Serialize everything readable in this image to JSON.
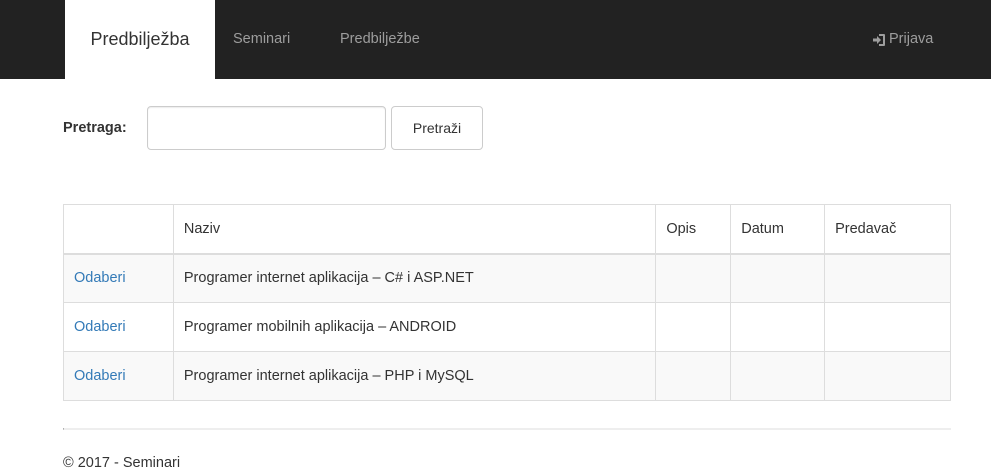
{
  "navbar": {
    "brand": "Predbilježba",
    "links": [
      {
        "label": "Seminari"
      },
      {
        "label": "Predbilježbe"
      }
    ],
    "login": {
      "label": "Prijava",
      "icon": "log-in-icon"
    },
    "background": "#222222",
    "link_color": "#9d9d9d"
  },
  "search": {
    "label": "Pretraga:",
    "value": "",
    "placeholder": "",
    "button_label": "Pretraži"
  },
  "table": {
    "headers": [
      "",
      "Naziv",
      "Opis",
      "Datum",
      "Predavač"
    ],
    "rows": [
      {
        "action": "Odaberi",
        "naziv": "Programer internet aplikacija – C# i ASP.NET",
        "opis": "",
        "datum": "",
        "predavac": ""
      },
      {
        "action": "Odaberi",
        "naziv": "Programer mobilnih aplikacija – ANDROID",
        "opis": "",
        "datum": "",
        "predavac": ""
      },
      {
        "action": "Odaberi",
        "naziv": "Programer internet aplikacija – PHP i MySQL",
        "opis": "",
        "datum": "",
        "predavac": ""
      }
    ],
    "link_color": "#337ab7",
    "stripe_color": "#f9f9f9"
  },
  "footer": {
    "text": "© 2017 - Seminari"
  }
}
